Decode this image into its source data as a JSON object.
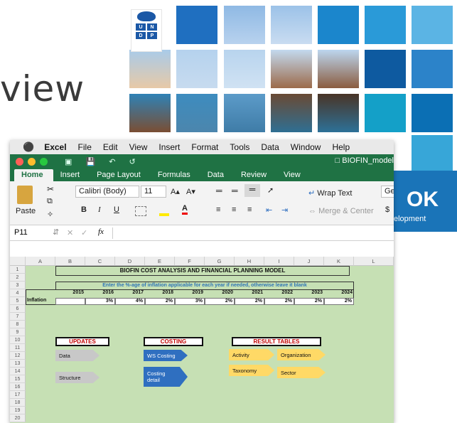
{
  "slide": {
    "title_fragment": "view",
    "undp": {
      "l1": "U",
      "l2": "N",
      "l3": "D",
      "l4": "P"
    },
    "badge_title": "OK",
    "badge_sub": "elopment"
  },
  "macmenu": {
    "apple": "",
    "app": "Excel",
    "items": [
      "File",
      "Edit",
      "View",
      "Insert",
      "Format",
      "Tools",
      "Data",
      "Window",
      "Help"
    ]
  },
  "window": {
    "filename": "BIOFIN_model"
  },
  "ribbon_tabs": [
    "Home",
    "Insert",
    "Page Layout",
    "Formulas",
    "Data",
    "Review",
    "View"
  ],
  "ribbon": {
    "paste": "Paste",
    "font_name": "Calibri (Body)",
    "font_size": "11",
    "grow": "A▴",
    "shrink": "A▾",
    "bold": "B",
    "italic": "I",
    "underline": "U",
    "wrap_text": "Wrap Text",
    "merge_center": "Merge & Center",
    "number_format": "Ge",
    "currency": "$"
  },
  "formula": {
    "cell_ref": "P11",
    "cancel": "✕",
    "enter": "✓",
    "fx": "fx"
  },
  "columns": [
    "A",
    "B",
    "C",
    "D",
    "E",
    "F",
    "G",
    "H",
    "I",
    "J",
    "K",
    "L"
  ],
  "rows": [
    "1",
    "2",
    "3",
    "4",
    "5",
    "6",
    "7",
    "8",
    "9",
    "10",
    "11",
    "12",
    "13",
    "14",
    "15",
    "16",
    "17",
    "18",
    "19",
    "20"
  ],
  "sheet": {
    "title": "BIOFIN COST ANALYSIS AND FINANCIAL PLANNING MODEL",
    "instruction": "Enter the %-age of inflation applicable for each year if needed, otherwise leave it blank",
    "years": [
      "2015",
      "2016",
      "2017",
      "2018",
      "2019",
      "2020",
      "2021",
      "2022",
      "2023",
      "2024"
    ],
    "inflation_label": "Inflation",
    "inflation": [
      "",
      "3%",
      "4%",
      "2%",
      "3%",
      "2%",
      "2%",
      "2%",
      "2%",
      "2%"
    ],
    "sections": {
      "updates": "UPDATES",
      "costing": "COSTING",
      "results": "RESULT TABLES"
    },
    "buttons": {
      "data": "Data",
      "structure": "Structure",
      "ws_costing": "WS Costing",
      "costing_detail_1": "Costing",
      "costing_detail_2": "detail",
      "activity": "Activity",
      "organization": "Organization",
      "taxonomy": "Taxonomy",
      "sector": "Sector"
    }
  },
  "colors": {
    "excel_green": "#1f7244",
    "sheet_bg": "#c6e0b4",
    "section_red": "#c00000",
    "arrow_blue": "#2f6fc0",
    "arrow_gray": "#c0c0c0",
    "arrow_gold": "#ffd966"
  }
}
